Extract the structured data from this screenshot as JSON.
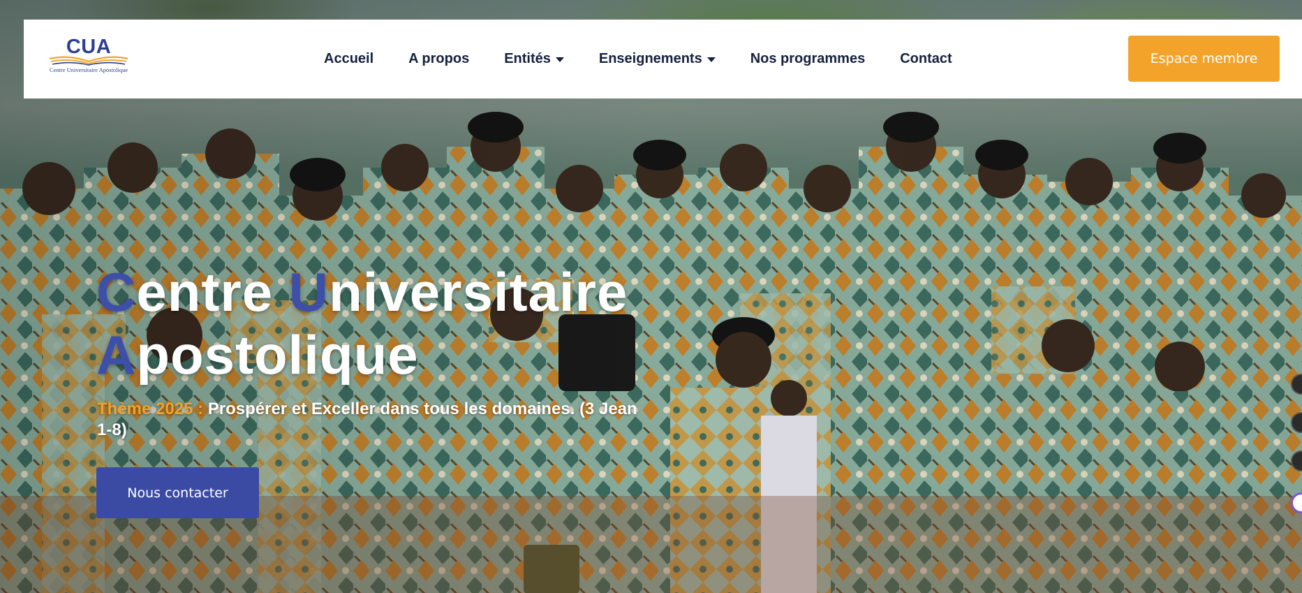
{
  "brand": {
    "logo_mark": "CUA",
    "logo_subtitle": "Centre Universitaire Apostolique"
  },
  "nav": {
    "items": [
      {
        "label": "Accueil",
        "dropdown": false
      },
      {
        "label": "A propos",
        "dropdown": false
      },
      {
        "label": "Entités",
        "dropdown": true
      },
      {
        "label": "Enseignements",
        "dropdown": true
      },
      {
        "label": "Nos programmes",
        "dropdown": false
      },
      {
        "label": "Contact",
        "dropdown": false
      }
    ],
    "cta_label": "Espace membre"
  },
  "hero": {
    "title_words": [
      {
        "initial": "C",
        "rest": "entre"
      },
      {
        "initial": "U",
        "rest": "niversitaire"
      },
      {
        "initial": "A",
        "rest": "postolique"
      }
    ],
    "theme_label": "Thème 2025 :",
    "theme_text": "Prospérer et Exceller dans tous les domaines. (3 Jean 1-8)",
    "button_label": "Nous contacter",
    "image": "group-photo"
  },
  "colors": {
    "accent_orange": "#f3a32a",
    "accent_blue": "#3b4ba3",
    "nav_text": "#15213f",
    "header_bg": "#ffffff"
  }
}
